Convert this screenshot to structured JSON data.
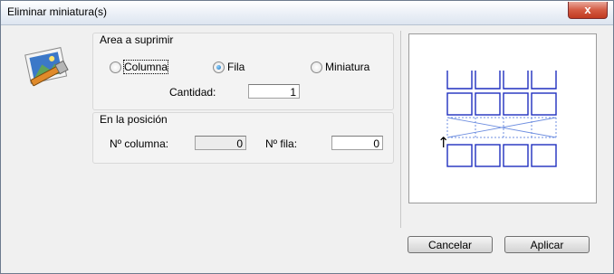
{
  "window": {
    "title": "Eliminar miniatura(s)",
    "close_glyph": "x"
  },
  "area_group": {
    "title": "Area a suprimir",
    "options": [
      {
        "label": "Columna",
        "checked": false
      },
      {
        "label": "Fila",
        "checked": true
      },
      {
        "label": "Miniatura",
        "checked": false
      }
    ],
    "quantity_label": "Cantidad:",
    "quantity_value": "1"
  },
  "position_group": {
    "title": "En la posición",
    "column_label": "Nº columna:",
    "column_value": "0",
    "row_label": "Nº fila:",
    "row_value": "0"
  },
  "preview": {
    "arrow_glyph": "↑",
    "accent": "#1f2fbf"
  },
  "buttons": {
    "cancel": "Cancelar",
    "apply": "Aplicar"
  }
}
